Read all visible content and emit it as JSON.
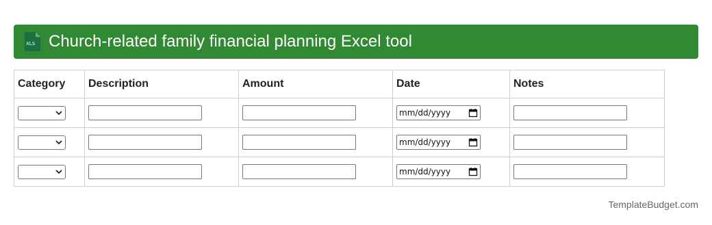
{
  "header": {
    "icon": "xls-file-icon",
    "icon_text": "XLS",
    "title": "Church-related family financial planning Excel tool",
    "background_color": "#318a33"
  },
  "table": {
    "columns": [
      "Category",
      "Description",
      "Amount",
      "Date",
      "Notes"
    ],
    "rows": [
      {
        "category": "",
        "description": "",
        "amount": "",
        "date_placeholder": "mm/dd/yyyy",
        "notes": ""
      },
      {
        "category": "",
        "description": "",
        "amount": "",
        "date_placeholder": "mm/dd/yyyy",
        "notes": ""
      },
      {
        "category": "",
        "description": "",
        "amount": "",
        "date_placeholder": "mm/dd/yyyy",
        "notes": ""
      }
    ]
  },
  "footer": {
    "brand": "TemplateBudget.com"
  }
}
